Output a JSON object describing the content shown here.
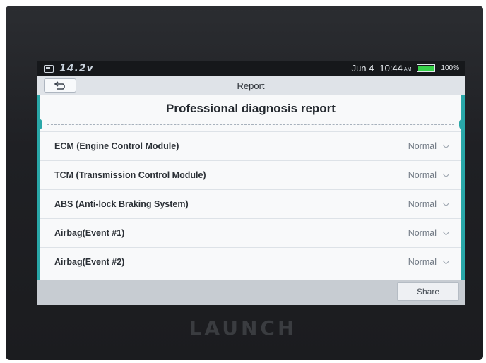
{
  "status_bar": {
    "voltage": "14.2v",
    "date": "Jun 4",
    "time": "10:44",
    "ampm": "AM",
    "battery_percent": "100%",
    "battery_level": 1.0,
    "battery_color": "#37d14a"
  },
  "header": {
    "title": "Report"
  },
  "report": {
    "heading": "Professional diagnosis report",
    "rows": [
      {
        "label": "ECM (Engine Control Module)",
        "status": "Normal"
      },
      {
        "label": "TCM (Transmission Control Module)",
        "status": "Normal"
      },
      {
        "label": "ABS (Anti-lock Braking System)",
        "status": "Normal"
      },
      {
        "label": "Airbag(Event #1)",
        "status": "Normal"
      },
      {
        "label": "Airbag(Event #2)",
        "status": "Normal"
      }
    ]
  },
  "footer": {
    "share_label": "Share"
  },
  "device": {
    "brand": "LAUNCH"
  },
  "colors": {
    "accent": "#29a7a8"
  }
}
